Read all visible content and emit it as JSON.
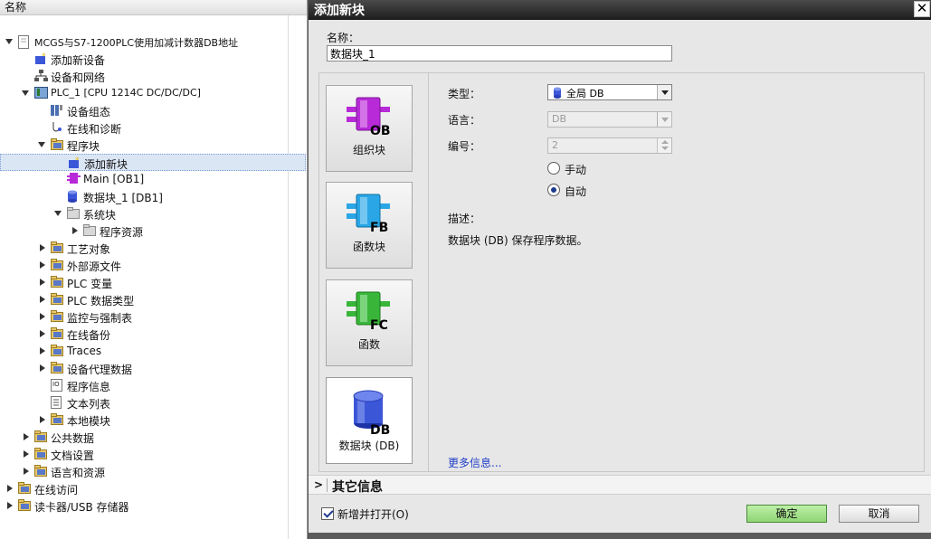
{
  "tree": {
    "header": "名称",
    "items": [
      {
        "label": "MCGS与S7-1200PLC使用加减计数器DB地址",
        "icon": "project-file-icon",
        "toggle": "exp"
      },
      {
        "label": "添加新设备",
        "icon": "add-device-icon",
        "toggle": ""
      },
      {
        "label": "设备和网络",
        "icon": "network-icon",
        "toggle": ""
      },
      {
        "label": "PLC_1 [CPU 1214C DC/DC/DC]",
        "icon": "plc-icon",
        "toggle": "exp"
      },
      {
        "label": "设备组态",
        "icon": "device-config-icon",
        "toggle": ""
      },
      {
        "label": "在线和诊断",
        "icon": "diagnostics-icon",
        "toggle": ""
      },
      {
        "label": "程序块",
        "icon": "folder-icon",
        "toggle": "exp"
      },
      {
        "label": "添加新块",
        "icon": "add-block-icon",
        "toggle": ""
      },
      {
        "label": "Main [OB1]",
        "icon": "ob-block-icon",
        "toggle": ""
      },
      {
        "label": "数据块_1 [DB1]",
        "icon": "db-block-icon",
        "toggle": ""
      },
      {
        "label": "系统块",
        "icon": "system-folder-icon",
        "toggle": "exp"
      },
      {
        "label": "程序资源",
        "icon": "system-folder-icon",
        "toggle": "col"
      },
      {
        "label": "工艺对象",
        "icon": "folder-icon",
        "toggle": "col"
      },
      {
        "label": "外部源文件",
        "icon": "folder-icon",
        "toggle": "col"
      },
      {
        "label": "PLC 变量",
        "icon": "folder-icon",
        "toggle": "col"
      },
      {
        "label": "PLC 数据类型",
        "icon": "folder-icon",
        "toggle": "col"
      },
      {
        "label": "监控与强制表",
        "icon": "folder-icon",
        "toggle": "col"
      },
      {
        "label": "在线备份",
        "icon": "folder-icon",
        "toggle": "col"
      },
      {
        "label": "Traces",
        "icon": "folder-icon",
        "toggle": "col"
      },
      {
        "label": "设备代理数据",
        "icon": "folder-icon",
        "toggle": "col"
      },
      {
        "label": "程序信息",
        "icon": "info-doc-icon",
        "toggle": ""
      },
      {
        "label": "文本列表",
        "icon": "text-list-icon",
        "toggle": ""
      },
      {
        "label": "本地模块",
        "icon": "folder-icon",
        "toggle": "col"
      },
      {
        "label": "公共数据",
        "icon": "folder-icon",
        "toggle": "col"
      },
      {
        "label": "文档设置",
        "icon": "folder-icon",
        "toggle": "col"
      },
      {
        "label": "语言和资源",
        "icon": "folder-icon",
        "toggle": "col"
      },
      {
        "label": "在线访问",
        "icon": "folder-icon",
        "toggle": "col"
      },
      {
        "label": "读卡器/USB 存储器",
        "icon": "folder-icon",
        "toggle": "col"
      }
    ]
  },
  "dialog": {
    "title": "添加新块",
    "name_label": "名称：",
    "name_value": "数据块_1",
    "blocks": [
      {
        "label": "组织块",
        "tag": "OB",
        "color": "#b82ad8",
        "icon": "ob-icon"
      },
      {
        "label": "函数块",
        "tag": "FB",
        "color": "#2aa6e6",
        "icon": "fb-icon"
      },
      {
        "label": "函数",
        "tag": "FC",
        "color": "#39b63a",
        "icon": "fc-icon"
      },
      {
        "label": "数据块 (DB)",
        "tag": "DB",
        "color": "#3b57d8",
        "icon": "db-icon"
      }
    ],
    "type_label": "类型：",
    "type_value": "全局 DB",
    "language_label": "语言：",
    "language_value": "DB",
    "number_label": "编号：",
    "number_value": "2",
    "radio_manual": "手动",
    "radio_auto": "自动",
    "description_label": "描述：",
    "description_text": "数据块 (DB) 保存程序数据。",
    "more_info": "更多信息...",
    "other_info": "其它信息",
    "other_chevron": ">",
    "add_open_label": "新增并打开(O)",
    "ok_label": "确定",
    "cancel_label": "取消",
    "close_glyph": "✕"
  }
}
